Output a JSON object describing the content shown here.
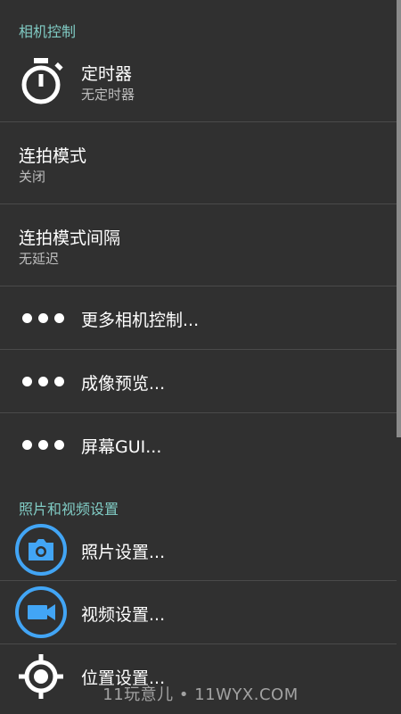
{
  "sections": {
    "camera_controls": "相机控制",
    "photo_video": "照片和视频设置"
  },
  "items": {
    "timer": {
      "title": "定时器",
      "summary": "无定时器",
      "icon": "timer-icon"
    },
    "burst_mode": {
      "title": "连拍模式",
      "summary": "关闭"
    },
    "burst_interval": {
      "title": "连拍模式间隔",
      "summary": "无延迟"
    },
    "more_controls": {
      "title": "更多相机控制...",
      "icon": "more-dots-icon"
    },
    "preview": {
      "title": "成像预览...",
      "icon": "more-dots-icon"
    },
    "screen_gui": {
      "title": "屏幕GUI...",
      "icon": "more-dots-icon"
    },
    "photo_settings": {
      "title": "照片设置...",
      "icon": "camera-icon"
    },
    "video_settings": {
      "title": "视频设置...",
      "icon": "videocam-icon"
    },
    "location_settings": {
      "title": "位置设置...",
      "icon": "gps-icon"
    }
  },
  "watermark": "11玩意儿 • 11WYX.COM",
  "colors": {
    "background": "#303030",
    "section_header": "#80cbc4",
    "icon_blue": "#42a5f5",
    "divider": "#4a4a4a"
  }
}
